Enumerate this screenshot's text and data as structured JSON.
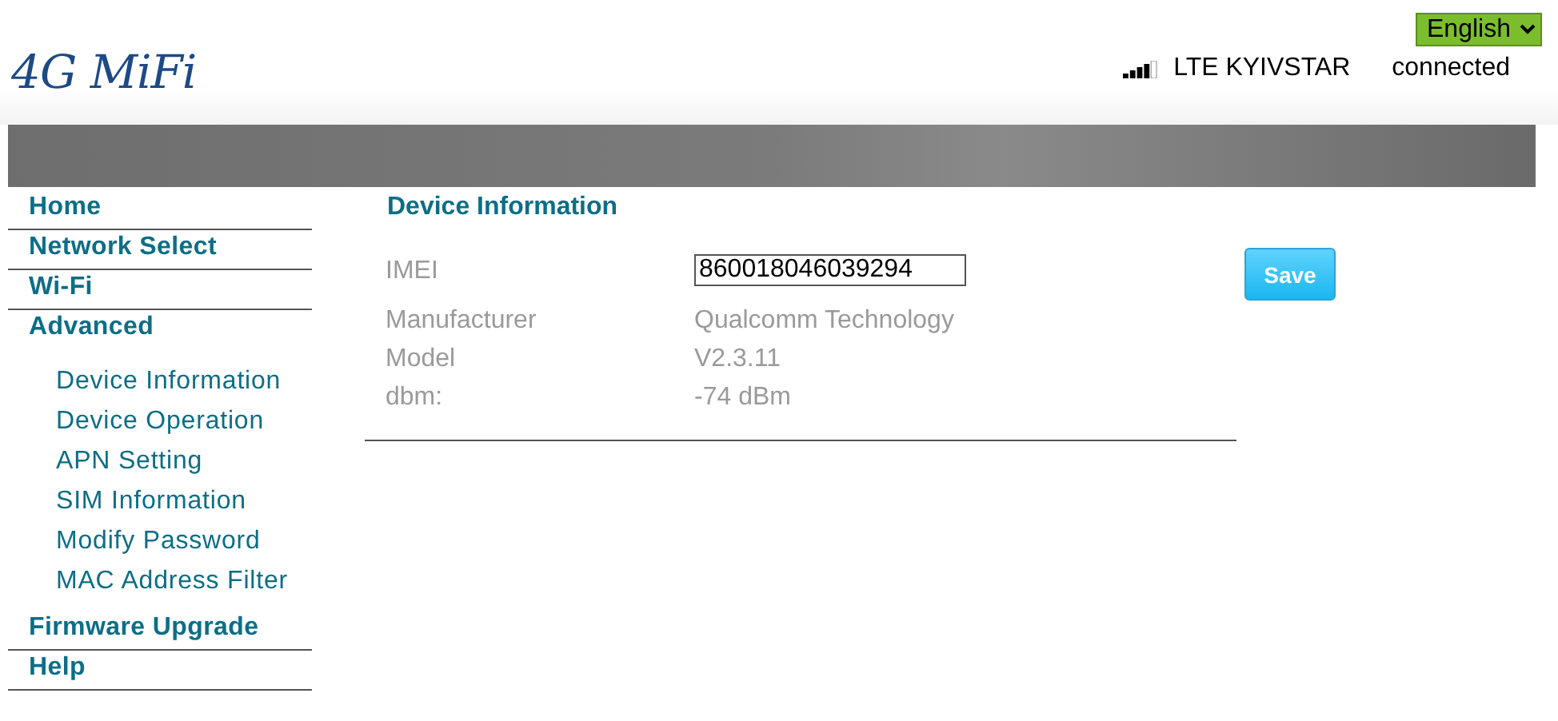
{
  "header": {
    "logo": "4G MiFi",
    "language": "English",
    "network": "LTE KYIVSTAR",
    "status": "connected"
  },
  "sidebar": {
    "items": [
      {
        "label": "Home"
      },
      {
        "label": "Network Select"
      },
      {
        "label": "Wi-Fi"
      },
      {
        "label": "Advanced",
        "children": [
          {
            "label": "Device Information"
          },
          {
            "label": "Device Operation"
          },
          {
            "label": "APN Setting"
          },
          {
            "label": "SIM Information"
          },
          {
            "label": "Modify Password"
          },
          {
            "label": "MAC Address Filter"
          }
        ]
      },
      {
        "label": "Firmware Upgrade"
      },
      {
        "label": "Help"
      }
    ]
  },
  "content": {
    "title": "Device Information",
    "fields": [
      {
        "kind": "input",
        "label": "IMEI",
        "value": "860018046039294"
      },
      {
        "kind": "text",
        "label": "Manufacturer",
        "value": "Qualcomm Technology"
      },
      {
        "kind": "text",
        "label": "Model",
        "value": "V2.3.11"
      },
      {
        "kind": "text",
        "label": "dbm:",
        "value": "-74 dBm"
      }
    ],
    "save_button": "Save"
  }
}
